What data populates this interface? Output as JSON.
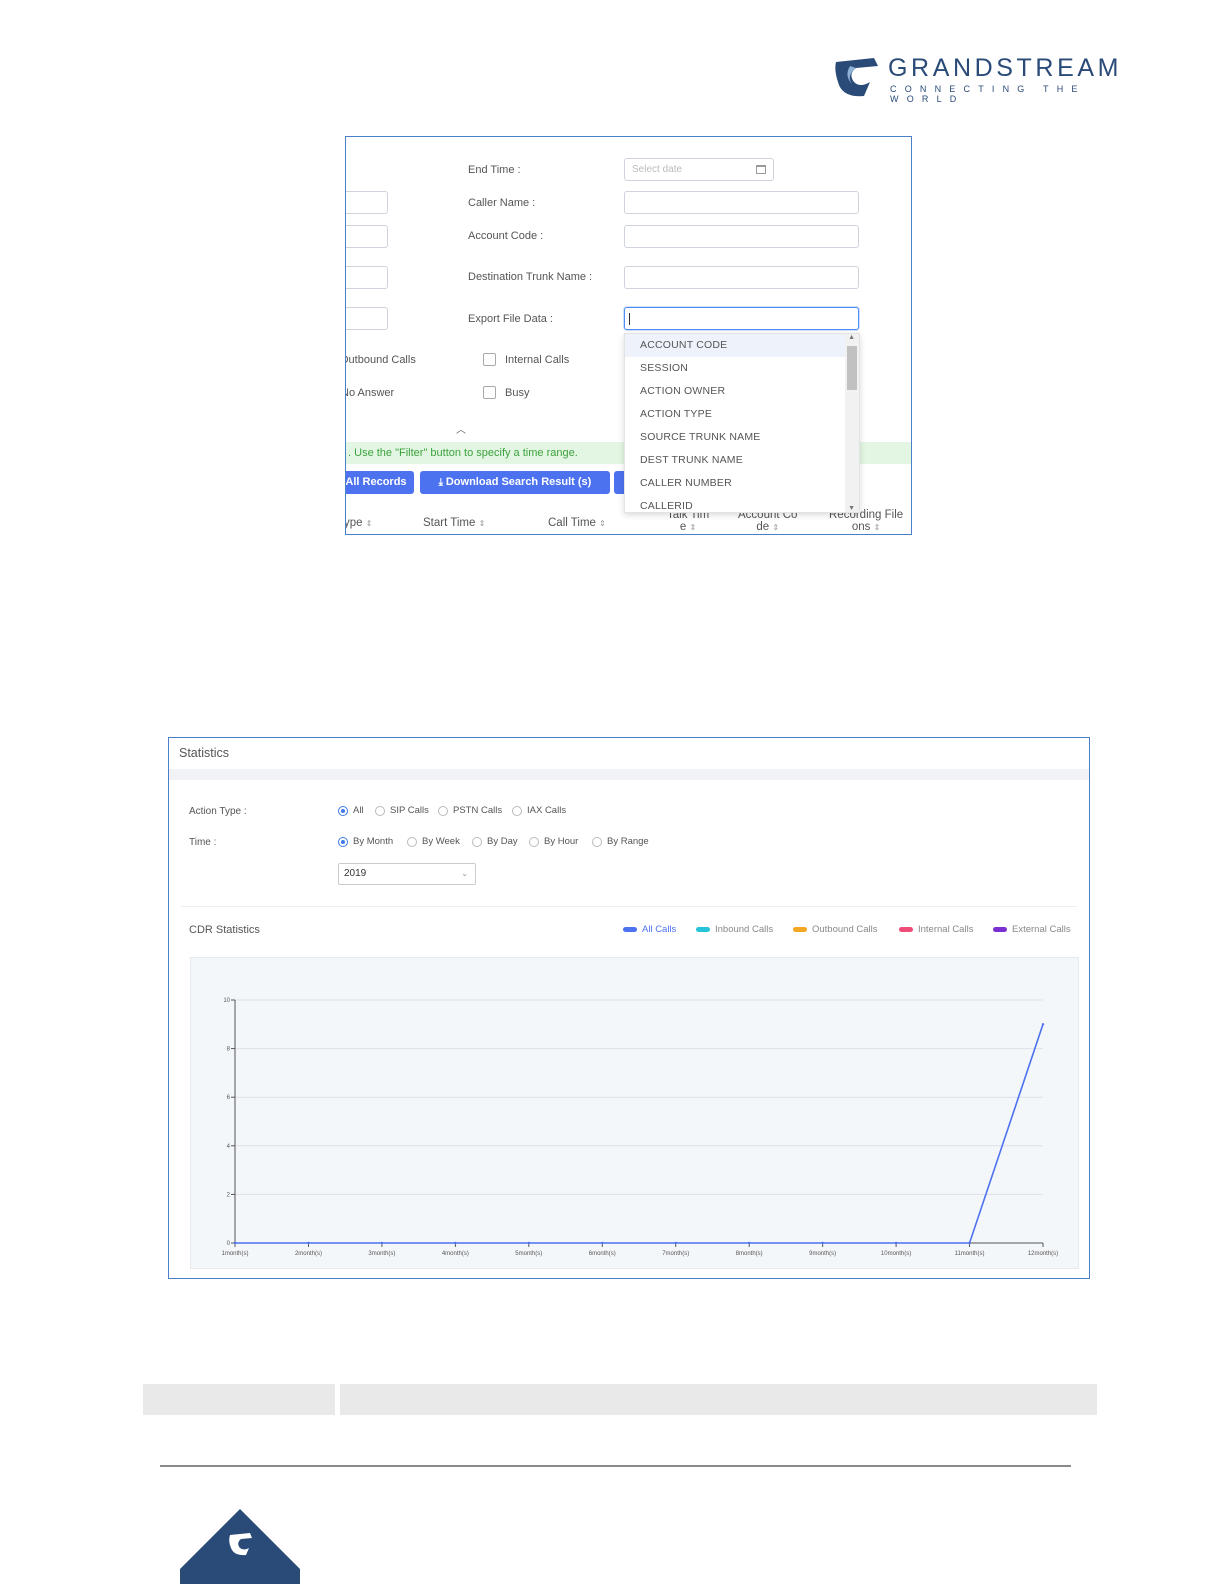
{
  "header": {
    "brand": "GRANDSTREAM",
    "tagline": "CONNECTING THE WORLD",
    "brand_color": "#2a4a78"
  },
  "filter_panel": {
    "end_time_label": "End Time :",
    "end_time_placeholder": "Select date",
    "caller_name_label": "Caller Name :",
    "account_code_label": "Account Code :",
    "dest_trunk_label": "Destination Trunk Name :",
    "export_label": "Export File Data :",
    "checkboxes": {
      "outbound": "Outbound Calls",
      "internal": "Internal Calls",
      "no_answer": "No Answer",
      "busy": "Busy"
    },
    "export_options": [
      "ACCOUNT CODE",
      "SESSION",
      "ACTION OWNER",
      "ACTION TYPE",
      "SOURCE TRUNK NAME",
      "DEST TRUNK NAME",
      "CALLER NUMBER",
      "CALLERID"
    ],
    "hint": "Use the \"Filter\" button to specify a time range.",
    "buttons": {
      "all_records": "All Records",
      "download": "Download Search Result (s)"
    },
    "columns": {
      "type": "ype",
      "start_time": "Start Time",
      "call_time": "Call Time",
      "talk_time_1": "Talk Tim",
      "talk_time_2": "e",
      "account_code_1": "Account Co",
      "account_code_2": "de",
      "recording_1": "Recording File",
      "recording_2": "ons"
    }
  },
  "statistics": {
    "title": "Statistics",
    "action_type_label": "Action Type :",
    "action_types": [
      "All",
      "SIP Calls",
      "PSTN Calls",
      "IAX Calls"
    ],
    "action_type_selected": "All",
    "time_label": "Time :",
    "time_options": [
      "By Month",
      "By Week",
      "By Day",
      "By Hour",
      "By Range"
    ],
    "time_selected": "By Month",
    "year": "2019",
    "cdr_title": "CDR Statistics",
    "legend": [
      {
        "name": "All Calls",
        "color": "#4d72f0"
      },
      {
        "name": "Inbound Calls",
        "color": "#27c3d9"
      },
      {
        "name": "Outbound Calls",
        "color": "#f5a623"
      },
      {
        "name": "Internal Calls",
        "color": "#ef4d77"
      },
      {
        "name": "External Calls",
        "color": "#7b2fd1"
      }
    ]
  },
  "chart_data": {
    "type": "line",
    "categories": [
      "1month(s)",
      "2month(s)",
      "3month(s)",
      "4month(s)",
      "5month(s)",
      "6month(s)",
      "7month(s)",
      "8month(s)",
      "9month(s)",
      "10month(s)",
      "11month(s)",
      "12month(s)"
    ],
    "series": [
      {
        "name": "All Calls",
        "color": "#4d72f0",
        "values": [
          0,
          0,
          0,
          0,
          0,
          0,
          0,
          0,
          0,
          0,
          0,
          9
        ]
      }
    ],
    "yticks": [
      0,
      2,
      4,
      6,
      8,
      10
    ],
    "ylim": [
      0,
      10
    ],
    "grid": true,
    "legend_position": "top-right"
  }
}
